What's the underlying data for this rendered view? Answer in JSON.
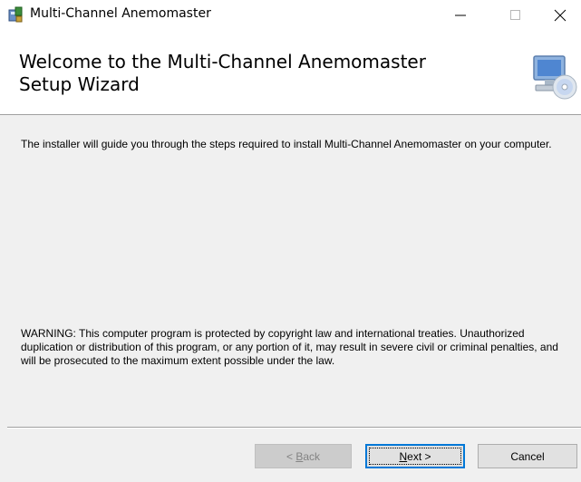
{
  "window": {
    "title": "Multi-Channel Anemomaster",
    "controls": {
      "minimize": "minimize-icon",
      "maximize": "maximize-icon",
      "close": "close-icon"
    }
  },
  "header": {
    "title_line1": "Welcome to the Multi-Channel Anemomaster",
    "title_line2": "Setup Wizard"
  },
  "body": {
    "intro": "The installer will guide you through the steps required to install Multi-Channel Anemomaster on your computer.",
    "warning": "WARNING: This computer program is protected by copyright law and international treaties. Unauthorized duplication or distribution of this program, or any portion of it, may result in severe civil or criminal penalties, and will be prosecuted to the maximum extent possible under the law."
  },
  "buttons": {
    "back": {
      "prefix": "< ",
      "mnemonic": "B",
      "rest": "ack",
      "enabled": false
    },
    "next": {
      "mnemonic": "N",
      "rest": "ext >",
      "enabled": true,
      "default": true
    },
    "cancel": {
      "label": "Cancel",
      "enabled": true
    }
  },
  "colors": {
    "window_bg": "#f0f0f0",
    "header_bg": "#ffffff",
    "accent_border": "#0078d7",
    "disabled_text": "#838383"
  }
}
